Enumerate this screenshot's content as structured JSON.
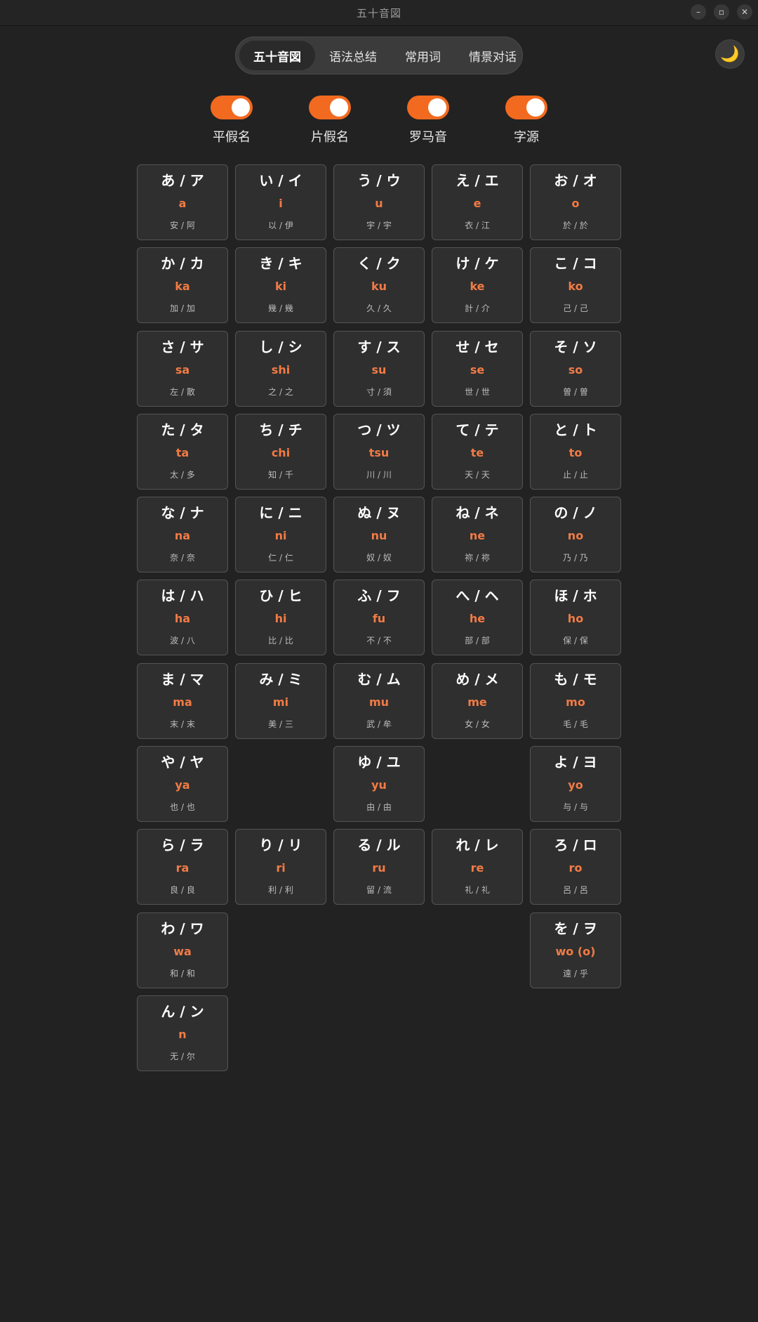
{
  "window": {
    "title": "五十音図"
  },
  "tabs": [
    {
      "label": "五十音図",
      "active": true
    },
    {
      "label": "语法总结",
      "active": false
    },
    {
      "label": "常用词",
      "active": false
    },
    {
      "label": "情景对话",
      "active": false
    }
  ],
  "theme_toggle": {
    "icon": "moon-icon"
  },
  "toggles": [
    {
      "label": "平假名",
      "on": true
    },
    {
      "label": "片假名",
      "on": true
    },
    {
      "label": "罗马音",
      "on": true
    },
    {
      "label": "字源",
      "on": true
    }
  ],
  "colors": {
    "accent": "#f26a1f",
    "romaji": "#f27b45",
    "background": "#222222",
    "card": "#2f2f2f"
  },
  "rows": [
    [
      {
        "kana": "あ / ア",
        "romaji": "a",
        "origin": "安 / 阿"
      },
      {
        "kana": "い / イ",
        "romaji": "i",
        "origin": "以 / 伊"
      },
      {
        "kana": "う / ウ",
        "romaji": "u",
        "origin": "宇 / 宇"
      },
      {
        "kana": "え / エ",
        "romaji": "e",
        "origin": "衣 / 江"
      },
      {
        "kana": "お / オ",
        "romaji": "o",
        "origin": "於 / 於"
      }
    ],
    [
      {
        "kana": "か / カ",
        "romaji": "ka",
        "origin": "加 / 加"
      },
      {
        "kana": "き / キ",
        "romaji": "ki",
        "origin": "幾 / 幾"
      },
      {
        "kana": "く / ク",
        "romaji": "ku",
        "origin": "久 / 久"
      },
      {
        "kana": "け / ケ",
        "romaji": "ke",
        "origin": "計 / 介"
      },
      {
        "kana": "こ / コ",
        "romaji": "ko",
        "origin": "己 / 己"
      }
    ],
    [
      {
        "kana": "さ / サ",
        "romaji": "sa",
        "origin": "左 / 散"
      },
      {
        "kana": "し / シ",
        "romaji": "shi",
        "origin": "之 / 之"
      },
      {
        "kana": "す / ス",
        "romaji": "su",
        "origin": "寸 / 須"
      },
      {
        "kana": "せ / セ",
        "romaji": "se",
        "origin": "世 / 世"
      },
      {
        "kana": "そ / ソ",
        "romaji": "so",
        "origin": "曽 / 曽"
      }
    ],
    [
      {
        "kana": "た / タ",
        "romaji": "ta",
        "origin": "太 / 多"
      },
      {
        "kana": "ち / チ",
        "romaji": "chi",
        "origin": "知 / 千"
      },
      {
        "kana": "つ / ツ",
        "romaji": "tsu",
        "origin": "川 / 川"
      },
      {
        "kana": "て / テ",
        "romaji": "te",
        "origin": "天 / 天"
      },
      {
        "kana": "と / ト",
        "romaji": "to",
        "origin": "止 / 止"
      }
    ],
    [
      {
        "kana": "な / ナ",
        "romaji": "na",
        "origin": "奈 / 奈"
      },
      {
        "kana": "に / ニ",
        "romaji": "ni",
        "origin": "仁 / 仁"
      },
      {
        "kana": "ぬ / ヌ",
        "romaji": "nu",
        "origin": "奴 / 奴"
      },
      {
        "kana": "ね / ネ",
        "romaji": "ne",
        "origin": "祢 / 祢"
      },
      {
        "kana": "の / ノ",
        "romaji": "no",
        "origin": "乃 / 乃"
      }
    ],
    [
      {
        "kana": "は / ハ",
        "romaji": "ha",
        "origin": "波 / 八"
      },
      {
        "kana": "ひ / ヒ",
        "romaji": "hi",
        "origin": "比 / 比"
      },
      {
        "kana": "ふ / フ",
        "romaji": "fu",
        "origin": "不 / 不"
      },
      {
        "kana": "へ / ヘ",
        "romaji": "he",
        "origin": "部 / 部"
      },
      {
        "kana": "ほ / ホ",
        "romaji": "ho",
        "origin": "保 / 保"
      }
    ],
    [
      {
        "kana": "ま / マ",
        "romaji": "ma",
        "origin": "末 / 末"
      },
      {
        "kana": "み / ミ",
        "romaji": "mi",
        "origin": "美 / 三"
      },
      {
        "kana": "む / ム",
        "romaji": "mu",
        "origin": "武 / 牟"
      },
      {
        "kana": "め / メ",
        "romaji": "me",
        "origin": "女 / 女"
      },
      {
        "kana": "も / モ",
        "romaji": "mo",
        "origin": "毛 / 毛"
      }
    ],
    [
      {
        "kana": "や / ヤ",
        "romaji": "ya",
        "origin": "也 / 也"
      },
      null,
      {
        "kana": "ゆ / ユ",
        "romaji": "yu",
        "origin": "由 / 由"
      },
      null,
      {
        "kana": "よ / ヨ",
        "romaji": "yo",
        "origin": "与 / 与"
      }
    ],
    [
      {
        "kana": "ら / ラ",
        "romaji": "ra",
        "origin": "良 / 良"
      },
      {
        "kana": "り / リ",
        "romaji": "ri",
        "origin": "利 / 利"
      },
      {
        "kana": "る / ル",
        "romaji": "ru",
        "origin": "留 / 流"
      },
      {
        "kana": "れ / レ",
        "romaji": "re",
        "origin": "礼 / 礼"
      },
      {
        "kana": "ろ / ロ",
        "romaji": "ro",
        "origin": "呂 / 呂"
      }
    ],
    [
      {
        "kana": "わ / ワ",
        "romaji": "wa",
        "origin": "和 / 和"
      },
      null,
      null,
      null,
      {
        "kana": "を / ヲ",
        "romaji": "wo (o)",
        "origin": "遠 / 乎"
      }
    ],
    [
      {
        "kana": "ん / ン",
        "romaji": "n",
        "origin": "无 / 尔"
      },
      null,
      null,
      null,
      null
    ]
  ]
}
